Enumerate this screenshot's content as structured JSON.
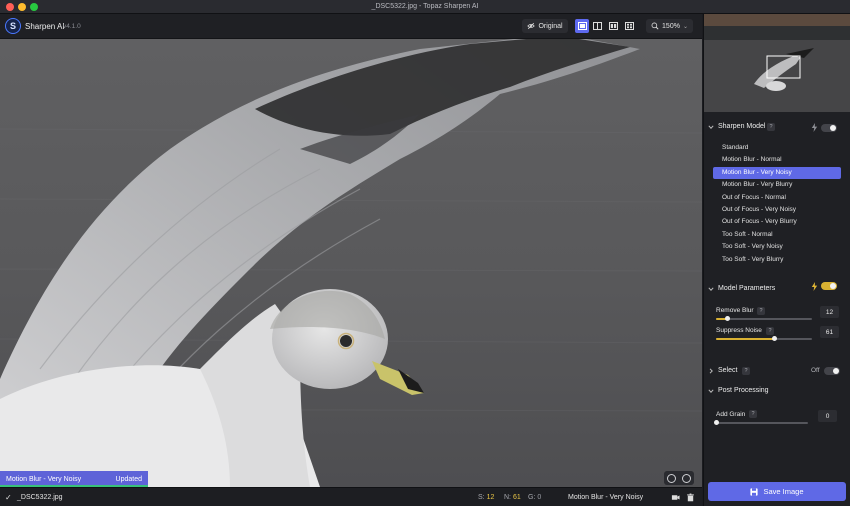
{
  "window": {
    "title": "_DSC5322.jpg - Topaz Sharpen AI"
  },
  "app": {
    "logo_letter": "S",
    "name": "Sharpen AI",
    "version": "v4.1.0"
  },
  "toolbar": {
    "original_label": "Original",
    "zoom": "150%",
    "active_view": "single",
    "zoom_caret": "⌄"
  },
  "canvas": {
    "status_model": "Motion Blur - Very Noisy",
    "status_state": "Updated",
    "progress": 1.0
  },
  "bottom": {
    "check": "✓",
    "file_name": "_DSC5322.jpg",
    "s_label": "S:",
    "s_value": "12",
    "n_label": "N:",
    "n_value": "61",
    "g_label": "G:",
    "g_value": "0",
    "model": "Motion Blur - Very Noisy"
  },
  "panel": {
    "help_glyph": "?",
    "sharpen_model": {
      "title": "Sharpen Model",
      "enabled": false,
      "selected_index": 2,
      "models": [
        "Standard",
        "Motion Blur - Normal",
        "Motion Blur - Very Noisy",
        "Motion Blur - Very Blurry",
        "Out of Focus - Normal",
        "Out of Focus - Very Noisy",
        "Out of Focus - Very Blurry",
        "Too Soft - Normal",
        "Too Soft - Very Noisy",
        "Too Soft - Very Blurry"
      ]
    },
    "model_parameters": {
      "title": "Model Parameters",
      "auto": true,
      "remove_blur": {
        "label": "Remove Blur",
        "value": "12",
        "fraction": 0.12
      },
      "suppress_noise": {
        "label": "Suppress Noise",
        "value": "61",
        "fraction": 0.61
      }
    },
    "select": {
      "title": "Select",
      "state_label": "Off",
      "enabled": false
    },
    "post_processing": {
      "title": "Post Processing",
      "add_grain": {
        "label": "Add Grain",
        "value": "0",
        "fraction": 0.0
      }
    },
    "save_label": "Save Image"
  },
  "colors": {
    "accent": "#5f69e6",
    "gold": "#d9b132",
    "success": "#38c07a"
  }
}
